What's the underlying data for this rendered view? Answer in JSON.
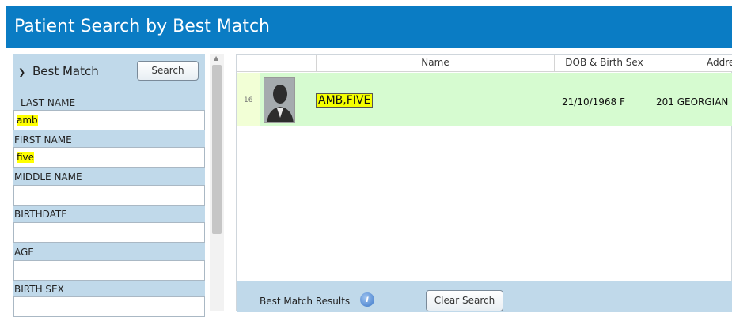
{
  "header": {
    "title": "Patient Search by Best Match"
  },
  "left_panel": {
    "section_title": "Best Match",
    "search_button": "Search",
    "fields": [
      {
        "label": "LAST NAME",
        "value": "amb"
      },
      {
        "label": "FIRST NAME",
        "value": "five"
      },
      {
        "label": "MIDDLE NAME",
        "value": ""
      },
      {
        "label": "BIRTHDATE",
        "value": ""
      },
      {
        "label": "AGE",
        "value": ""
      },
      {
        "label": "BIRTH SEX",
        "value": ""
      }
    ]
  },
  "grid": {
    "columns": [
      "Name",
      "DOB & Birth Sex",
      "Addre"
    ],
    "rows": [
      {
        "row_number": "16",
        "name": "AMB,FIVE",
        "dob_sex": "21/10/1968 F",
        "address": "201 GEORGIAN"
      }
    ],
    "footer_label": "Best Match Results",
    "clear_button": "Clear Search"
  },
  "colors": {
    "header_bg": "#0a7cc4",
    "panel_bg": "#c0d9ea",
    "selected_row_bg": "#d6fbd0",
    "highlight": "#ffff00"
  },
  "icons": [
    "chevron-down-icon",
    "info-icon",
    "avatar-silhouette-icon",
    "scroll-up-arrow-icon"
  ]
}
